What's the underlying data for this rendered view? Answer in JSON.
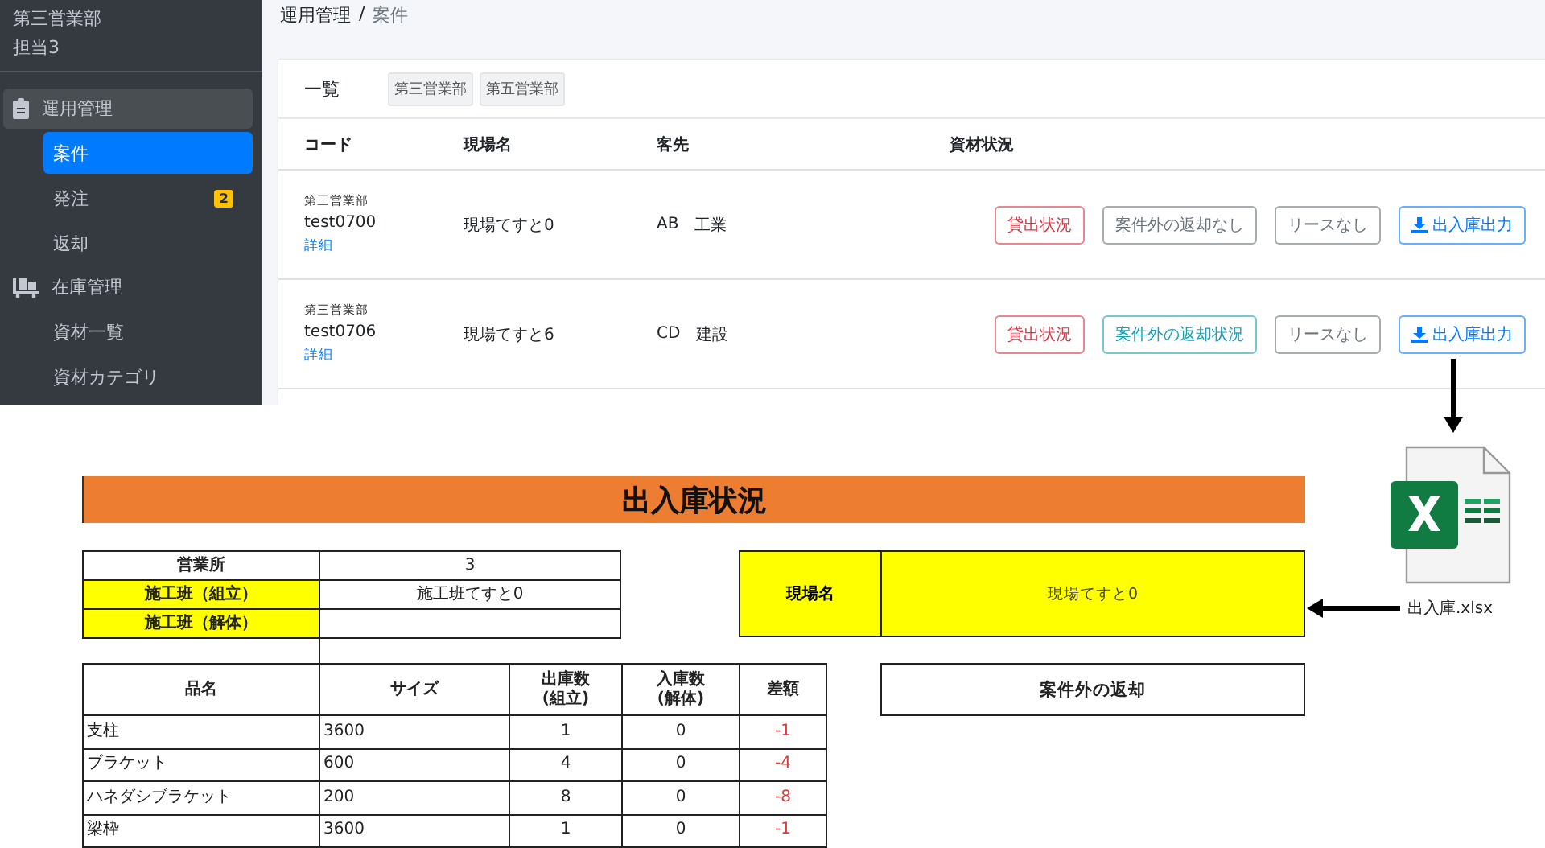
{
  "sidebar": {
    "header_lines": [
      "第三営業部",
      "担当3"
    ],
    "groups": [
      {
        "label": "運用管理",
        "selected": true,
        "items": [
          {
            "label": "案件",
            "selected": true
          },
          {
            "label": "発注",
            "selected": false,
            "badge": "2"
          },
          {
            "label": "返却",
            "selected": false
          }
        ]
      },
      {
        "label": "在庫管理",
        "selected": false,
        "items": [
          {
            "label": "資材一覧",
            "selected": false
          },
          {
            "label": "資材カテゴリ",
            "selected": false
          }
        ]
      }
    ]
  },
  "breadcrumb": [
    "運用管理",
    "/",
    "案件"
  ],
  "card": {
    "title": "一覧",
    "filters": [
      "第三営業部",
      "第五営業部"
    ],
    "columns": [
      "コード",
      "現場名",
      "客先",
      "資材状況"
    ],
    "rows": [
      {
        "department": "第三営業部",
        "code": "test0700",
        "detail_link": "詳細",
        "site": "現場てすと0",
        "client_code": "AB",
        "client_name": "工業",
        "buttons": [
          {
            "label": "貸出状況",
            "kind": "danger"
          },
          {
            "label": "案件外の返却なし",
            "kind": "secondary"
          },
          {
            "label": "リースなし",
            "kind": "secondary"
          },
          {
            "label": "出入庫出力",
            "kind": "primary"
          }
        ]
      },
      {
        "department": "第三営業部",
        "code": "test0706",
        "detail_link": "詳細",
        "site": "現場てすと6",
        "client_code": "CD",
        "client_name": "建設",
        "buttons": [
          {
            "label": "貸出状況",
            "kind": "danger"
          },
          {
            "label": "案件外の返却状況",
            "kind": "info"
          },
          {
            "label": "リースなし",
            "kind": "secondary"
          },
          {
            "label": "出入庫出力",
            "kind": "primary"
          }
        ]
      }
    ]
  },
  "sheet": {
    "title": "出入庫状況",
    "info_rows": [
      {
        "label": "営業所",
        "value": "3",
        "highlighted": false
      },
      {
        "label": "施工班（組立）",
        "value": "施工班てすと0",
        "highlighted": true
      },
      {
        "label": "施工班（解体）",
        "highlighted": true
      }
    ],
    "site": {
      "label": "現場名",
      "value": "現場てすと0"
    },
    "return_box": "案件外の返却",
    "columns": [
      "品名",
      "サイズ",
      "出庫数\n(組立)",
      "入庫数\n(解体)",
      "差額"
    ],
    "rows": [
      [
        "支柱",
        "3600",
        "1",
        "0",
        "-1"
      ],
      [
        "ブラケット",
        "600",
        "4",
        "0",
        "-4"
      ],
      [
        "ハネダシブラケット",
        "200",
        "8",
        "0",
        "-8"
      ],
      [
        "梁枠",
        "3600",
        "1",
        "0",
        "-1"
      ]
    ]
  },
  "file": {
    "name": "出入庫.xlsx"
  }
}
